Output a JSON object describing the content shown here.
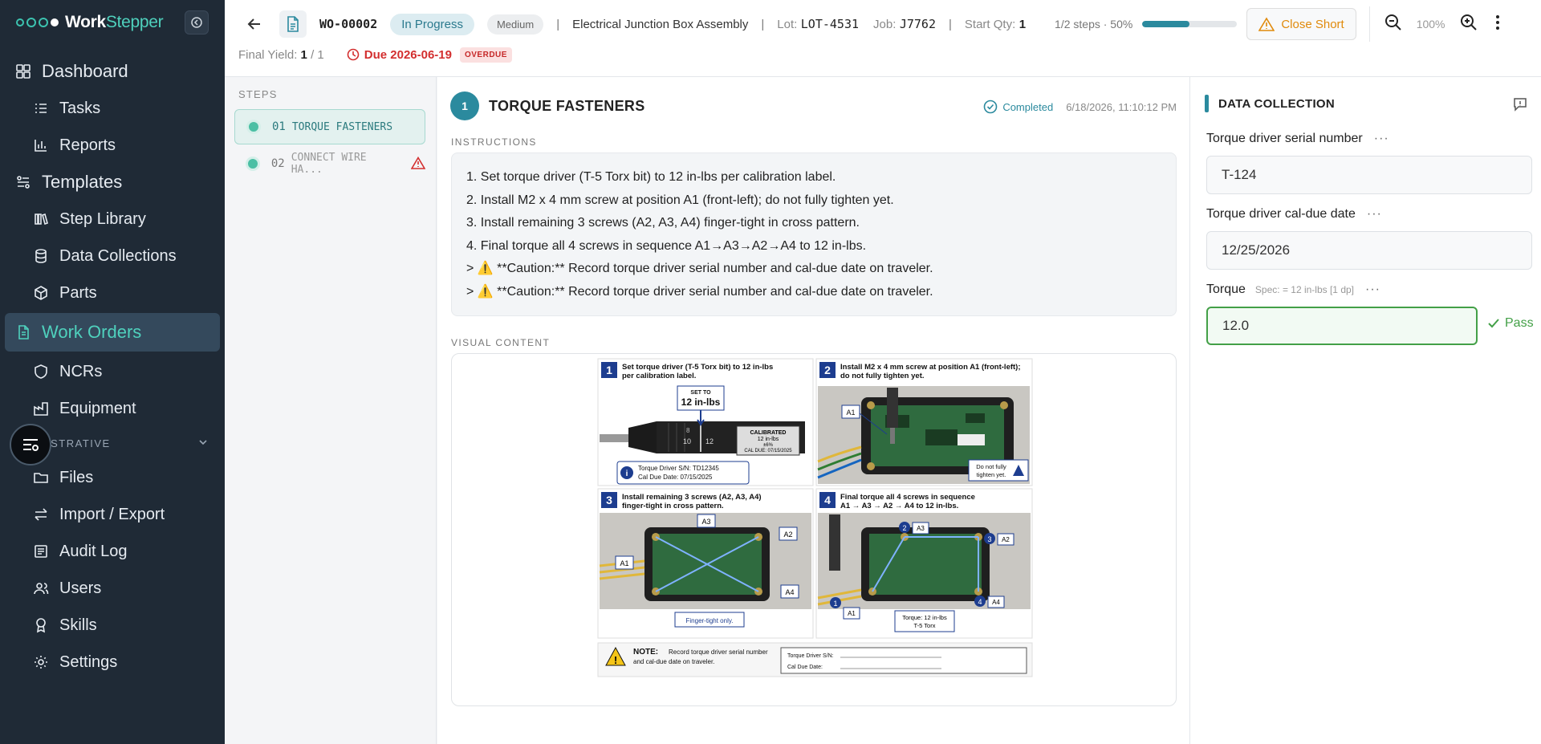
{
  "app": {
    "brand_part1": "Work",
    "brand_part2": "Stepper"
  },
  "sidebar": {
    "items": [
      {
        "label": "Dashboard"
      },
      {
        "label": "Tasks"
      },
      {
        "label": "Reports"
      },
      {
        "label": "Templates"
      },
      {
        "label": "Step Library"
      },
      {
        "label": "Data Collections"
      },
      {
        "label": "Parts"
      },
      {
        "label": "Work Orders"
      },
      {
        "label": "NCRs"
      },
      {
        "label": "Equipment"
      },
      {
        "label": "Files"
      },
      {
        "label": "Import / Export"
      },
      {
        "label": "Audit Log"
      },
      {
        "label": "Users"
      },
      {
        "label": "Skills"
      },
      {
        "label": "Settings"
      }
    ],
    "section_admin": "ISTRATIVE"
  },
  "header": {
    "wo_id": "WO-00002",
    "status": "In Progress",
    "priority": "Medium",
    "separator": "|",
    "product": "Electrical Junction Box Assembly",
    "lot_label": "Lot:",
    "lot_value": "LOT-4531",
    "job_label": "Job:",
    "job_value": "J7762",
    "start_qty_label": "Start Qty:",
    "start_qty_value": "1",
    "steps_info": "1/2 steps · 50%",
    "progress_fraction": 0.5,
    "close_short": "Close Short",
    "zoom": "100%",
    "final_yield_label": "Final Yield:",
    "final_yield_value": "1",
    "final_yield_total": "/ 1",
    "due": "Due 2026-06-19",
    "overdue": "OVERDUE"
  },
  "steps": {
    "title": "STEPS",
    "items": [
      {
        "num": "01",
        "label": "TORQUE FASTENERS"
      },
      {
        "num": "02",
        "label": "CONNECT WIRE HA..."
      }
    ]
  },
  "main": {
    "step_number": "1",
    "step_title": "TORQUE FASTENERS",
    "completed_label": "Completed",
    "completed_time": "6/18/2026, 11:10:12 PM",
    "instructions_label": "INSTRUCTIONS",
    "instructions": [
      "1. Set torque driver (T-5 Torx bit) to 12 in-lbs per calibration label.",
      "2. Install M2 x 4 mm screw at position A1 (front-left); do not fully tighten yet.",
      "3. Install remaining 3 screws (A2, A3, A4) finger-tight in cross pattern.",
      "4. Final torque all 4 screws in sequence A1→A3→A2→A4 to 12 in-lbs.",
      "> ⚠️ **Caution:** Record torque driver serial number and cal-due date on traveler.",
      "> ⚠️ **Caution:** Record torque driver serial number and cal-due date on traveler."
    ],
    "visual_label": "VISUAL CONTENT",
    "figure": {
      "p1_num": "1",
      "p1_line1": "Set torque driver (T-5 Torx bit) to 12 in-lbs",
      "p1_line2": "per calibration label.",
      "p1_setto": "SET TO",
      "p1_setval": "12 in-lbs",
      "p1_scale_8": "8",
      "p1_scale_10": "10",
      "p1_scale_12": "12",
      "p1_cal1": "CALIBRATED",
      "p1_cal2": "12 in-lbs",
      "p1_cal3": "±6%",
      "p1_cal4": "CAL DUE: 07/15/2025",
      "p1_info1": "Torque Driver S/N:  TD12345",
      "p1_info2": "Cal Due Date: 07/15/2025",
      "p2_num": "2",
      "p2_line1": "Install M2 x 4 mm screw at position A1 (front-left);",
      "p2_line2": "do not fully tighten yet.",
      "p2_a1": "A1",
      "p2_warn1": "Do not fully",
      "p2_warn2": "tighten yet.",
      "p3_num": "3",
      "p3_line1": "Install remaining 3 screws (A2, A3, A4)",
      "p3_line2": "finger-tight in cross pattern.",
      "p3_a1": "A1",
      "p3_a2": "A2",
      "p3_a3": "A3",
      "p3_a4": "A4",
      "p3_finger": "Finger-tight only.",
      "p4_num": "4",
      "p4_line1": "Final torque all 4 screws in sequence",
      "p4_line2": "A1 → A3 → A2 → A4 to 12 in-lbs.",
      "p4_a1": "A1",
      "p4_a2": "A2",
      "p4_a3": "A3",
      "p4_a4": "A4",
      "p4_s1": "1",
      "p4_s2": "2",
      "p4_s3": "3",
      "p4_s4": "4",
      "p4_torque1": "Torque: 12 in-lbs",
      "p4_torque2": "T-5 Torx",
      "note_title": "NOTE:",
      "note_line1": "Record torque driver serial number",
      "note_line2": "and cal-due date on traveler.",
      "note_sn": "Torque Driver S/N:",
      "note_cal": "Cal Due Date:"
    }
  },
  "data_collection": {
    "title": "DATA COLLECTION",
    "fields": [
      {
        "label": "Torque driver serial number",
        "value": "T-124",
        "spec": ""
      },
      {
        "label": "Torque driver cal-due date",
        "value": "12/25/2026",
        "spec": ""
      },
      {
        "label": "Torque",
        "value": "12.0",
        "spec": "Spec: = 12 in-lbs [1 dp]"
      }
    ],
    "more": "···",
    "pass_label": "Pass"
  },
  "colors": {
    "sidebar_bg": "#1f2a36",
    "accent_teal": "#2b8a9e",
    "brand_teal": "#4fd1bd",
    "overdue_red": "#d32f2f",
    "pass_green": "#43a047",
    "warning_orange": "#e08a0b"
  }
}
